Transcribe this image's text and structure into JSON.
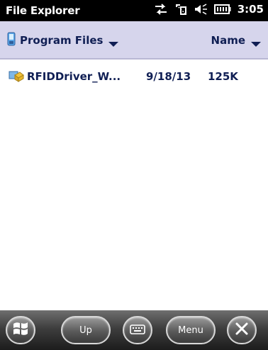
{
  "status_bar": {
    "app_title": "File Explorer",
    "time": "3:05",
    "icons": [
      "connectivity-arrows-icon",
      "sync-icon",
      "volume-muted-icon",
      "battery-icon"
    ]
  },
  "path_bar": {
    "folder": "Program Files",
    "folder_icon": "device-icon",
    "sort_label": "Name"
  },
  "files": [
    {
      "name": "RFIDDriver_W...",
      "date": "9/18/13",
      "size": "125K",
      "icon": "cab-package-icon"
    }
  ],
  "softkeys": {
    "start_icon": "windows-flag-icon",
    "up_label": "Up",
    "keyboard_icon": "keyboard-icon",
    "menu_label": "Menu",
    "close_icon": "close-icon"
  },
  "colors": {
    "header_bg": "#d6d5ec",
    "text": "#101f54",
    "title_bar": "#000000"
  }
}
